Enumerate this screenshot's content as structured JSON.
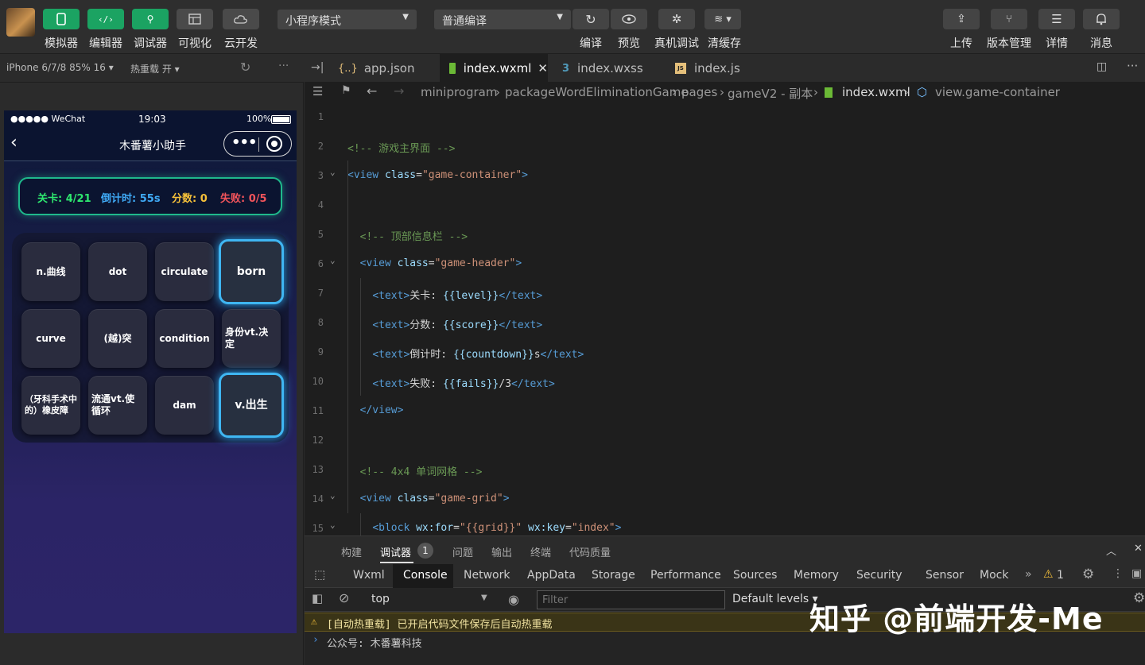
{
  "toolbar": {
    "left_buttons": [
      {
        "label": "模拟器",
        "icon": "phone-icon"
      },
      {
        "label": "编辑器",
        "icon": "code-icon"
      },
      {
        "label": "调试器",
        "icon": "debug-icon"
      },
      {
        "label": "可视化",
        "icon": "layout-icon"
      },
      {
        "label": "云开发",
        "icon": "cloud-icon"
      }
    ],
    "mode_select": "小程序模式",
    "compile_select": "普通编译",
    "center_buttons": [
      {
        "label": "编译",
        "icon": "refresh-icon"
      },
      {
        "label": "预览",
        "icon": "eye-icon"
      },
      {
        "label": "真机调试",
        "icon": "bug-icon"
      },
      {
        "label": "清缓存",
        "icon": "layers-icon"
      }
    ],
    "right_buttons": [
      {
        "label": "上传",
        "icon": "upload-icon"
      },
      {
        "label": "版本管理",
        "icon": "branch-icon"
      },
      {
        "label": "详情",
        "icon": "menu-icon"
      },
      {
        "label": "消息",
        "icon": "bell-icon"
      }
    ]
  },
  "simulator": {
    "device": "iPhone 6/7/8 85% 16 ▾",
    "hot_reload": "热重载 开 ▾",
    "status": {
      "carrier": "●●●●● WeChat",
      "time": "19:03",
      "battery": "100%"
    },
    "nav_title": "木番薯小助手",
    "header": {
      "level": "关卡: 4/21",
      "countdown": "倒计时: 55s",
      "score": "分数: 0",
      "fails": "失败: 0/5"
    },
    "colors": {
      "level": "#2ee86f",
      "countdown": "#3fa9f5",
      "score": "#f5c03a",
      "fails": "#f2545b"
    },
    "grid": [
      "n.曲线",
      "dot",
      "circulate",
      "born",
      "curve",
      "(越)突",
      "condition",
      "身份vt.决定",
      "（牙科手术中的）橡皮障",
      "流通vt.使循环",
      "dam",
      "v.出生"
    ],
    "selected": [
      3,
      11
    ]
  },
  "editor": {
    "tabs": [
      {
        "label": "app.json",
        "icon": "json-icon"
      },
      {
        "label": "index.wxml",
        "icon": "wxml-icon",
        "active": true
      },
      {
        "label": "index.wxss",
        "icon": "css-icon"
      },
      {
        "label": "index.js",
        "icon": "js-icon"
      }
    ],
    "breadcrumb": [
      "miniprogram",
      "packageWordEliminationGame",
      "pages",
      "gameV2 - 副本",
      "index.wxml",
      "view.game-container"
    ],
    "lines": [
      {
        "n": "1",
        "html": ""
      },
      {
        "n": "2",
        "html": "<span style='color:#6a9955'>&lt;!-- 游戏主界面 --&gt;</span>"
      },
      {
        "n": "3",
        "html": "<span style='color:#569cd6'>&lt;view</span> <span style='color:#9cdcfe'>class</span>=<span style='color:#ce9178'>\"game-container\"</span><span style='color:#569cd6'>&gt;</span>"
      },
      {
        "n": "4",
        "html": ""
      },
      {
        "n": "5",
        "html": "  <span style='color:#6a9955'>&lt;!-- 顶部信息栏 --&gt;</span>"
      },
      {
        "n": "6",
        "html": "  <span style='color:#569cd6'>&lt;view</span> <span style='color:#9cdcfe'>class</span>=<span style='color:#ce9178'>\"game-header\"</span><span style='color:#569cd6'>&gt;</span>"
      },
      {
        "n": "7",
        "html": "    <span style='color:#569cd6'>&lt;text&gt;</span>关卡: <span style='color:#9cdcfe'>{{level}}</span><span style='color:#569cd6'>&lt;/text&gt;</span>"
      },
      {
        "n": "8",
        "html": "    <span style='color:#569cd6'>&lt;text&gt;</span>分数: <span style='color:#9cdcfe'>{{score}}</span><span style='color:#569cd6'>&lt;/text&gt;</span>"
      },
      {
        "n": "9",
        "html": "    <span style='color:#569cd6'>&lt;text&gt;</span>倒计时: <span style='color:#9cdcfe'>{{countdown}}</span>s<span style='color:#569cd6'>&lt;/text&gt;</span>"
      },
      {
        "n": "10",
        "html": "    <span style='color:#569cd6'>&lt;text&gt;</span>失败: <span style='color:#9cdcfe'>{{fails}}</span>/3<span style='color:#569cd6'>&lt;/text&gt;</span>"
      },
      {
        "n": "11",
        "html": "  <span style='color:#569cd6'>&lt;/view&gt;</span>"
      },
      {
        "n": "12",
        "html": ""
      },
      {
        "n": "13",
        "html": "  <span style='color:#6a9955'>&lt;!-- 4x4 单词网格 --&gt;</span>"
      },
      {
        "n": "14",
        "html": "  <span style='color:#569cd6'>&lt;view</span> <span style='color:#9cdcfe'>class</span>=<span style='color:#ce9178'>\"game-grid\"</span><span style='color:#569cd6'>&gt;</span>"
      },
      {
        "n": "15",
        "html": "    <span style='color:#569cd6'>&lt;block</span> <span style='color:#9cdcfe'>wx:for</span>=<span style='color:#ce9178'>\"{{grid}}\"</span> <span style='color:#9cdcfe'>wx:key</span>=<span style='color:#ce9178'>\"index\"</span><span style='color:#569cd6'>&gt;</span>"
      }
    ],
    "folded_lines": [
      "3",
      "6",
      "14",
      "15"
    ]
  },
  "devtools": {
    "panel_tabs": [
      "构建",
      "调试器",
      "问题",
      "输出",
      "终端",
      "代码质量"
    ],
    "panel_badge": "1",
    "tabs": [
      "Wxml",
      "Console",
      "Network",
      "AppData",
      "Storage",
      "Performance",
      "Sources",
      "Memory",
      "Security",
      "Sensor",
      "Mock"
    ],
    "active_tab": "Console",
    "warning_count": "1",
    "context": "top",
    "filter_placeholder": "Filter",
    "levels": "Default levels ▾",
    "messages": [
      {
        "type": "warning",
        "text": "[自动热重载] 已开启代码文件保存后自动热重载"
      },
      {
        "type": "log",
        "text": "公众号: 木番薯科技"
      }
    ]
  },
  "watermark": "知乎 @前端开发-Me"
}
